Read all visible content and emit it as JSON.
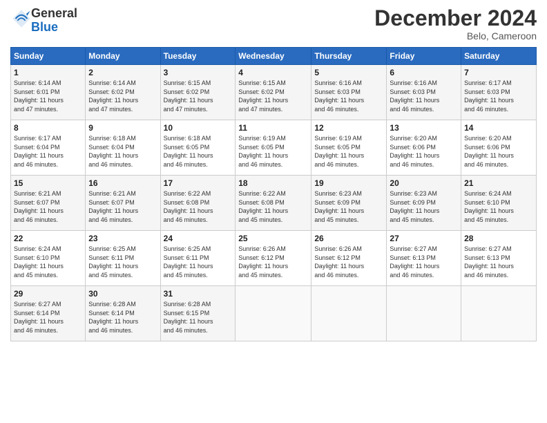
{
  "logo": {
    "line1": "General",
    "line2": "Blue"
  },
  "title": "December 2024",
  "location": "Belo, Cameroon",
  "days_of_week": [
    "Sunday",
    "Monday",
    "Tuesday",
    "Wednesday",
    "Thursday",
    "Friday",
    "Saturday"
  ],
  "weeks": [
    [
      {
        "day": "1",
        "info": "Sunrise: 6:14 AM\nSunset: 6:01 PM\nDaylight: 11 hours\nand 47 minutes."
      },
      {
        "day": "2",
        "info": "Sunrise: 6:14 AM\nSunset: 6:02 PM\nDaylight: 11 hours\nand 47 minutes."
      },
      {
        "day": "3",
        "info": "Sunrise: 6:15 AM\nSunset: 6:02 PM\nDaylight: 11 hours\nand 47 minutes."
      },
      {
        "day": "4",
        "info": "Sunrise: 6:15 AM\nSunset: 6:02 PM\nDaylight: 11 hours\nand 47 minutes."
      },
      {
        "day": "5",
        "info": "Sunrise: 6:16 AM\nSunset: 6:03 PM\nDaylight: 11 hours\nand 46 minutes."
      },
      {
        "day": "6",
        "info": "Sunrise: 6:16 AM\nSunset: 6:03 PM\nDaylight: 11 hours\nand 46 minutes."
      },
      {
        "day": "7",
        "info": "Sunrise: 6:17 AM\nSunset: 6:03 PM\nDaylight: 11 hours\nand 46 minutes."
      }
    ],
    [
      {
        "day": "8",
        "info": "Sunrise: 6:17 AM\nSunset: 6:04 PM\nDaylight: 11 hours\nand 46 minutes."
      },
      {
        "day": "9",
        "info": "Sunrise: 6:18 AM\nSunset: 6:04 PM\nDaylight: 11 hours\nand 46 minutes."
      },
      {
        "day": "10",
        "info": "Sunrise: 6:18 AM\nSunset: 6:05 PM\nDaylight: 11 hours\nand 46 minutes."
      },
      {
        "day": "11",
        "info": "Sunrise: 6:19 AM\nSunset: 6:05 PM\nDaylight: 11 hours\nand 46 minutes."
      },
      {
        "day": "12",
        "info": "Sunrise: 6:19 AM\nSunset: 6:05 PM\nDaylight: 11 hours\nand 46 minutes."
      },
      {
        "day": "13",
        "info": "Sunrise: 6:20 AM\nSunset: 6:06 PM\nDaylight: 11 hours\nand 46 minutes."
      },
      {
        "day": "14",
        "info": "Sunrise: 6:20 AM\nSunset: 6:06 PM\nDaylight: 11 hours\nand 46 minutes."
      }
    ],
    [
      {
        "day": "15",
        "info": "Sunrise: 6:21 AM\nSunset: 6:07 PM\nDaylight: 11 hours\nand 46 minutes."
      },
      {
        "day": "16",
        "info": "Sunrise: 6:21 AM\nSunset: 6:07 PM\nDaylight: 11 hours\nand 46 minutes."
      },
      {
        "day": "17",
        "info": "Sunrise: 6:22 AM\nSunset: 6:08 PM\nDaylight: 11 hours\nand 46 minutes."
      },
      {
        "day": "18",
        "info": "Sunrise: 6:22 AM\nSunset: 6:08 PM\nDaylight: 11 hours\nand 45 minutes."
      },
      {
        "day": "19",
        "info": "Sunrise: 6:23 AM\nSunset: 6:09 PM\nDaylight: 11 hours\nand 45 minutes."
      },
      {
        "day": "20",
        "info": "Sunrise: 6:23 AM\nSunset: 6:09 PM\nDaylight: 11 hours\nand 45 minutes."
      },
      {
        "day": "21",
        "info": "Sunrise: 6:24 AM\nSunset: 6:10 PM\nDaylight: 11 hours\nand 45 minutes."
      }
    ],
    [
      {
        "day": "22",
        "info": "Sunrise: 6:24 AM\nSunset: 6:10 PM\nDaylight: 11 hours\nand 45 minutes."
      },
      {
        "day": "23",
        "info": "Sunrise: 6:25 AM\nSunset: 6:11 PM\nDaylight: 11 hours\nand 45 minutes."
      },
      {
        "day": "24",
        "info": "Sunrise: 6:25 AM\nSunset: 6:11 PM\nDaylight: 11 hours\nand 45 minutes."
      },
      {
        "day": "25",
        "info": "Sunrise: 6:26 AM\nSunset: 6:12 PM\nDaylight: 11 hours\nand 45 minutes."
      },
      {
        "day": "26",
        "info": "Sunrise: 6:26 AM\nSunset: 6:12 PM\nDaylight: 11 hours\nand 46 minutes."
      },
      {
        "day": "27",
        "info": "Sunrise: 6:27 AM\nSunset: 6:13 PM\nDaylight: 11 hours\nand 46 minutes."
      },
      {
        "day": "28",
        "info": "Sunrise: 6:27 AM\nSunset: 6:13 PM\nDaylight: 11 hours\nand 46 minutes."
      }
    ],
    [
      {
        "day": "29",
        "info": "Sunrise: 6:27 AM\nSunset: 6:14 PM\nDaylight: 11 hours\nand 46 minutes."
      },
      {
        "day": "30",
        "info": "Sunrise: 6:28 AM\nSunset: 6:14 PM\nDaylight: 11 hours\nand 46 minutes."
      },
      {
        "day": "31",
        "info": "Sunrise: 6:28 AM\nSunset: 6:15 PM\nDaylight: 11 hours\nand 46 minutes."
      },
      {
        "day": "",
        "info": ""
      },
      {
        "day": "",
        "info": ""
      },
      {
        "day": "",
        "info": ""
      },
      {
        "day": "",
        "info": ""
      }
    ]
  ]
}
